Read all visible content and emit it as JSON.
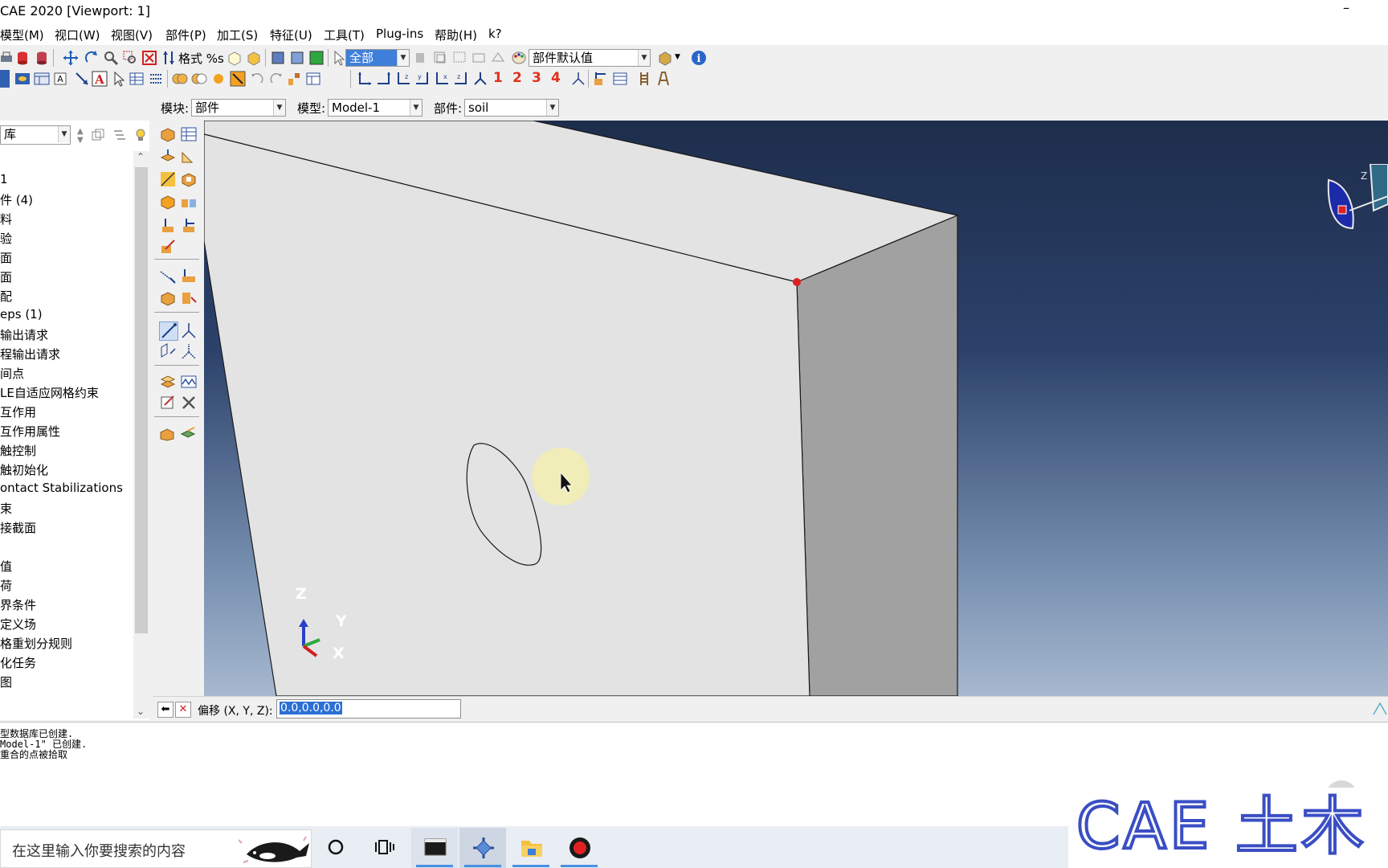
{
  "window": {
    "title": "CAE 2020 [Viewport: 1]",
    "minimize": "–"
  },
  "menu": [
    "模型(M)",
    "视口(W)",
    "视图(V)",
    "部件(P)",
    "加工(S)",
    "特征(U)",
    "工具(T)",
    "Plug-ins",
    "帮助(H)",
    "k?"
  ],
  "toolbar1": {
    "format_label": "格式 %s",
    "select_all": "全部",
    "render_style": "部件默认值"
  },
  "toolbar2": {
    "numbers": [
      "1",
      "2",
      "3",
      "4"
    ]
  },
  "context": {
    "module_label": "模块:",
    "module_value": "部件",
    "model_label": "模型:",
    "model_value": "Model-1",
    "part_label": "部件:",
    "part_value": "soil"
  },
  "tree": {
    "filter_value": "库",
    "items": [
      "1",
      "件 (4)",
      "料",
      "验",
      "面",
      "面",
      "配",
      "eps (1)",
      "输出请求",
      "程输出请求",
      "间点",
      "LE自适应网格约束",
      "互作用",
      "互作用属性",
      "触控制",
      "触初始化",
      "ontact Stabilizations",
      "束",
      "接截面",
      "",
      "值",
      "荷",
      "界条件",
      "定义场",
      "格重划分规则",
      "化任务",
      "图"
    ]
  },
  "triad": {
    "z": "Z",
    "y": "Y",
    "x": "X"
  },
  "minitriad": {
    "z": "Z"
  },
  "prompt": {
    "label": "偏移 (X, Y, Z):",
    "value": "0.0,0.0,0.0"
  },
  "messages": [
    "型数据库已创建.",
    "Model-1\" 已创建.",
    "重合的点被拾取"
  ],
  "taskbar": {
    "search_placeholder": "在这里输入你要搜索的内容"
  },
  "watermark": "CAE 土木",
  "colors": {
    "viewport_top": "#1d2d4c",
    "viewport_bottom": "#a7b8cf",
    "part_face": "#e3e3e3",
    "part_side": "#a1a1a1",
    "selected_point": "#e02020",
    "cursor_halo": "#f3efb0",
    "watermark": "#3a4ec4"
  }
}
